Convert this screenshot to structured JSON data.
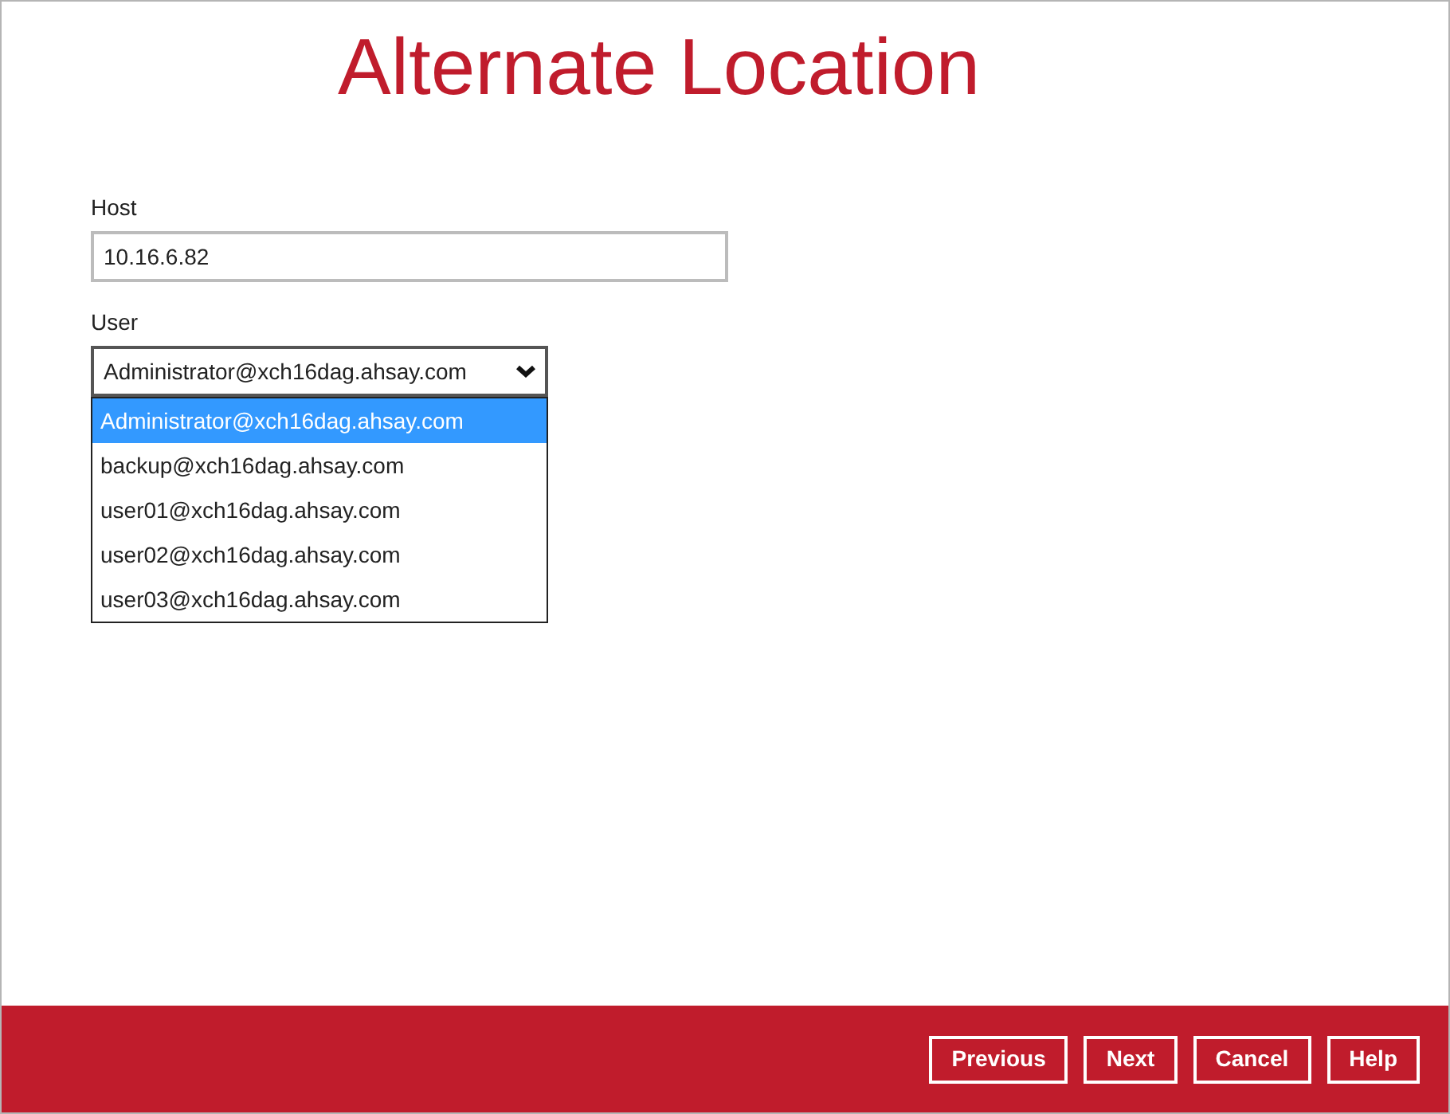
{
  "title": "Alternate Location",
  "host": {
    "label": "Host",
    "value": "10.16.6.82"
  },
  "user": {
    "label": "User",
    "value": "Administrator@xch16dag.ahsay.com",
    "expanded": true,
    "options": [
      {
        "label": "Administrator@xch16dag.ahsay.com",
        "selected": true
      },
      {
        "label": "backup@xch16dag.ahsay.com",
        "selected": false
      },
      {
        "label": "user01@xch16dag.ahsay.com",
        "selected": false
      },
      {
        "label": "user02@xch16dag.ahsay.com",
        "selected": false
      },
      {
        "label": "user03@xch16dag.ahsay.com",
        "selected": false
      }
    ]
  },
  "buttons": [
    "Previous",
    "Next",
    "Cancel",
    "Help"
  ]
}
